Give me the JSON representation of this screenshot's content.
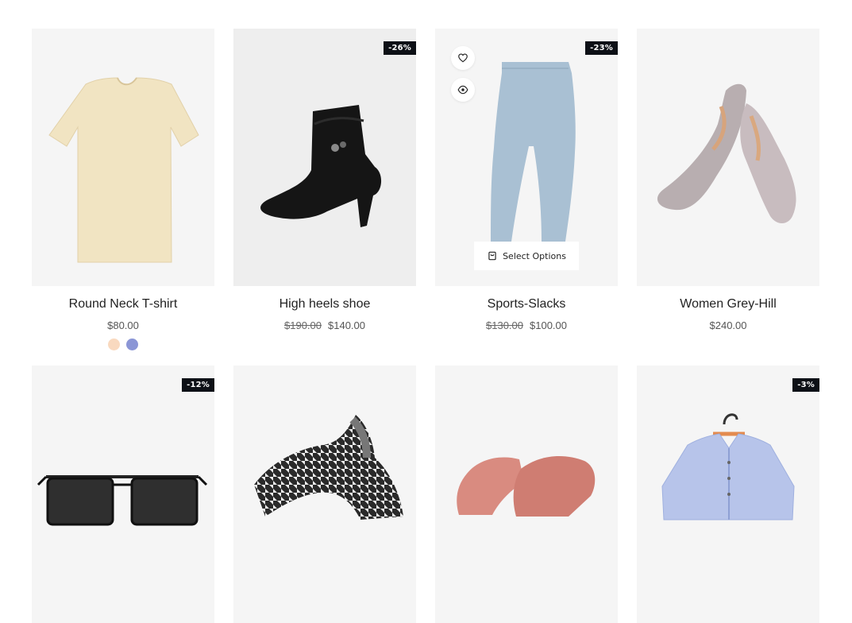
{
  "products": [
    {
      "title": "Round Neck T-shirt",
      "price": "$80.00",
      "colors": [
        "#f9d9bf",
        "#8b96d6"
      ]
    },
    {
      "title": "High heels shoe",
      "old_price": "$190.00",
      "price": "$140.00",
      "badge": "-26%"
    },
    {
      "title": "Sports-Slacks",
      "old_price": "$130.00",
      "price": "$100.00",
      "badge": "-23%",
      "action_label": "Select Options"
    },
    {
      "title": "Women Grey-Hill",
      "price": "$240.00"
    },
    {
      "badge": "-12%"
    },
    {},
    {},
    {
      "badge": "-3%"
    }
  ]
}
